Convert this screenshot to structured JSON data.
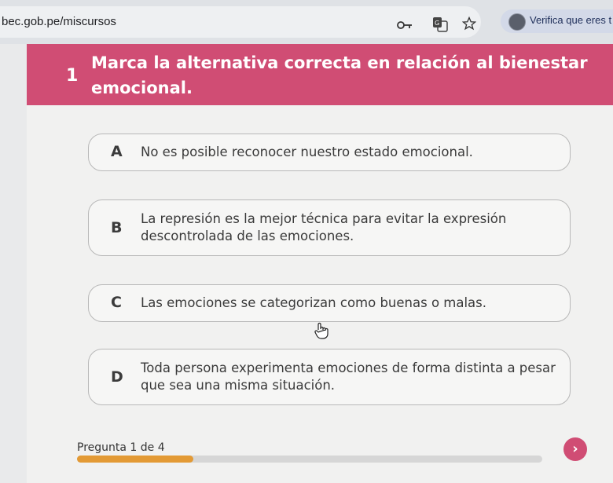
{
  "browser": {
    "url": "bec.gob.pe/miscursos",
    "extension_label": "Verifica que eres t"
  },
  "question": {
    "number": "1",
    "text": "Marca la alternativa correcta en relación al bienestar emocional."
  },
  "options": [
    {
      "letter": "A",
      "text": "No es posible reconocer nuestro estado emocional."
    },
    {
      "letter": "B",
      "text": "La represión es la mejor técnica para evitar la expresión descontrolada de las emociones."
    },
    {
      "letter": "C",
      "text": "Las emociones se categorizan como buenas o malas."
    },
    {
      "letter": "D",
      "text": "Toda persona experimenta emociones de forma distinta a pesar que sea una misma situación."
    }
  ],
  "footer": {
    "progress_label": "Pregunta 1 de 4",
    "progress_fraction": 0.25,
    "next_glyph": "›"
  },
  "colors": {
    "accent": "#d04d74",
    "progress": "#e39a35"
  },
  "icons": [
    "key-icon",
    "translate-icon",
    "star-icon",
    "user-avatar-icon",
    "hand-cursor-icon",
    "chevron-right-icon"
  ]
}
